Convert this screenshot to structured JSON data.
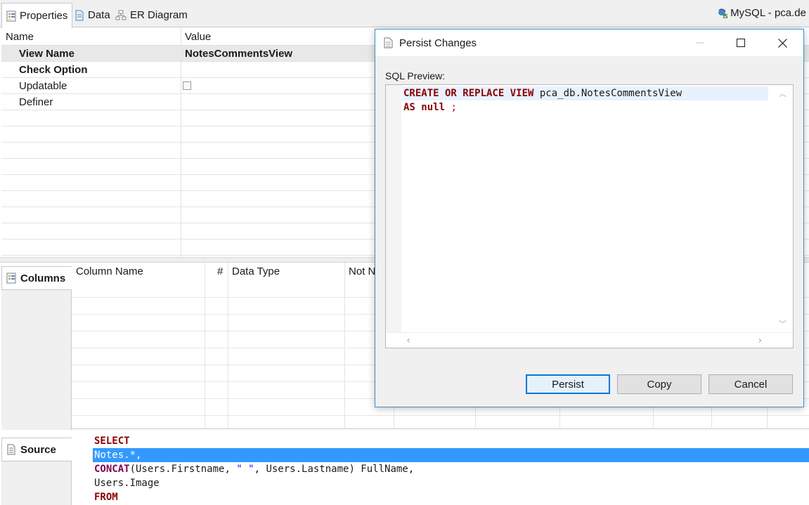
{
  "tabs": [
    {
      "label": "Properties",
      "icon": "properties-icon"
    },
    {
      "label": "Data",
      "icon": "data-icon"
    },
    {
      "label": "ER Diagram",
      "icon": "er-diagram-icon"
    }
  ],
  "connection": {
    "label": "MySQL - pca.de",
    "icon": "mysql-connection-icon"
  },
  "properties": {
    "headers": {
      "name": "Name",
      "value": "Value"
    },
    "rows": [
      {
        "name": "View Name",
        "value": "NotesCommentsView"
      },
      {
        "name": "Check Option",
        "value": ""
      },
      {
        "name": "Updatable",
        "value": "unchecked"
      },
      {
        "name": "Definer",
        "value": ""
      }
    ]
  },
  "columns_panel": {
    "tab_label": "Columns",
    "headers": {
      "name": "Column Name",
      "num": "#",
      "type": "Data Type",
      "notnull": "Not N"
    }
  },
  "source_panel": {
    "tab_label": "Source",
    "lines": {
      "l1": "SELECT",
      "l2": "Notes.*,",
      "l3a": "CONCAT",
      "l3b": "(Users.Firstname, ",
      "l3c": "\" \"",
      "l3d": ", Users.Lastname) FullName,",
      "l4": "Users.Image",
      "l5": "FROM"
    }
  },
  "dialog": {
    "title": "Persist Changes",
    "sql_label": "SQL Preview:",
    "sql": {
      "line1_kw": "CREATE OR REPLACE VIEW",
      "line1_rest": " pca_db.NotesCommentsView",
      "line2_kw": "AS null",
      "line2_rest": " ;"
    },
    "buttons": {
      "persist": "Persist",
      "copy": "Copy",
      "cancel": "Cancel"
    }
  },
  "colors": {
    "accent": "#0078d7",
    "selection": "#3399ff",
    "keyword": "#7f0055",
    "sql_keyword": "#8b0000"
  }
}
